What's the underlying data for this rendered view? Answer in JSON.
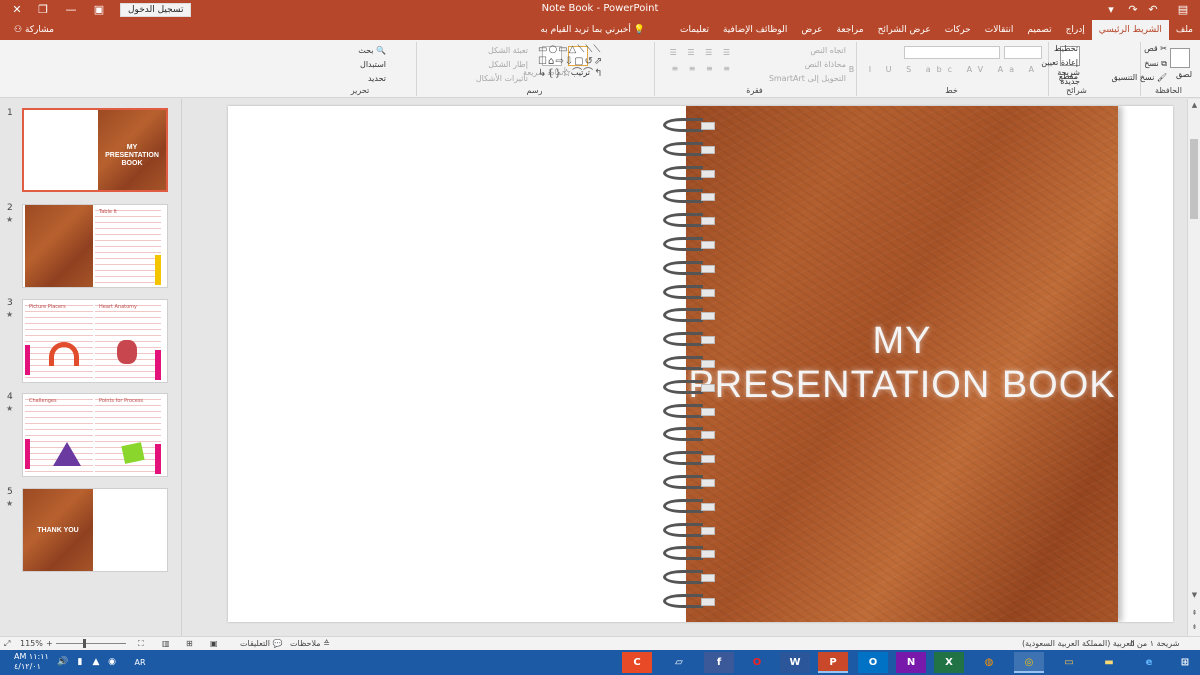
{
  "titlebar": {
    "title": "Note Book  -  PowerPoint",
    "signin": "تسجيل الدخول",
    "icons": [
      "close-icon",
      "restore-icon",
      "ribbon-display-icon",
      "minimize-icon",
      "maximize-icon",
      "window-close-icon",
      "save-icon",
      "undo-icon",
      "redo-icon",
      "customize-icon"
    ]
  },
  "tabs": {
    "items": [
      "ملف",
      "الشريط الرئيسي",
      "إدراج",
      "تصميم",
      "انتقالات",
      "حركات",
      "عرض الشرائح",
      "مراجعة",
      "عرض",
      "الوظائف الإضافية",
      "تعليمات"
    ],
    "active": "الشريط الرئيسي",
    "tellme": "أخبرني بما تريد القيام به",
    "share": "مشاركة"
  },
  "ribbon": {
    "clipboard": {
      "label": "الحافظة",
      "paste": "لصق",
      "cut": "قص",
      "copy": "نسخ",
      "format_painter": "نسخ التنسيق"
    },
    "slides": {
      "label": "شرائح",
      "new_slide": "شريحة جديدة",
      "layout": "تخطيط",
      "reset": "إعادة تعيين",
      "section": "مقطع"
    },
    "font": {
      "label": "خط"
    },
    "paragraph": {
      "label": "فقرة",
      "text_direction": "اتجاه النص",
      "align_text": "محاذاة النص",
      "smartart": "التحويل إلى SmartArt"
    },
    "drawing": {
      "label": "رسم",
      "arrange": "ترتيب",
      "quick_styles": "أنماط سريعة",
      "shape_fill": "تعبئة الشكل",
      "shape_outline": "إطار الشكل",
      "shape_effects": "تأثيرات الأشكال"
    },
    "editing": {
      "label": "تحرير",
      "find": "بحث",
      "replace": "استبدال",
      "select": "تحديد"
    }
  },
  "thumbnails": [
    {
      "num": "1",
      "star": "",
      "title": "MY PRESENTATION BOOK"
    },
    {
      "num": "2",
      "star": "★",
      "title": "Table It"
    },
    {
      "num": "3",
      "star": "★",
      "title_left": "Picture Placers",
      "title_right": "Heart Anatomy"
    },
    {
      "num": "4",
      "star": "★",
      "title_left": "Challenges",
      "title_right": "Points for Process"
    },
    {
      "num": "5",
      "star": "★",
      "title": "THANK YOU"
    }
  ],
  "slide": {
    "title_line1": "MY",
    "title_line2": "PRESENTATION BOOK"
  },
  "status": {
    "slide_info": "شريحة ١ من ٥",
    "language": "العربية (المملكة العربية السعودية)",
    "notes": "ملاحظات",
    "comments": "التعليقات",
    "zoom": "115%",
    "zoom_minus": "−",
    "zoom_plus": "+"
  },
  "taskbar": {
    "time": "AM ١١:١١",
    "date": "٤/١٢/٠١",
    "lang": "AR",
    "apps": [
      "desktop-icon",
      "edge-icon",
      "chrome-icon",
      "powerpoint-icon",
      "word-icon",
      "opera-icon",
      "firefox-icon",
      "excel-icon",
      "onenote-icon",
      "outlook-icon",
      "explorer-icon",
      "ie-icon"
    ]
  },
  "colors": {
    "accent": "#b7472a",
    "leather": "#a65428",
    "taskbar": "#1c5aa6"
  }
}
